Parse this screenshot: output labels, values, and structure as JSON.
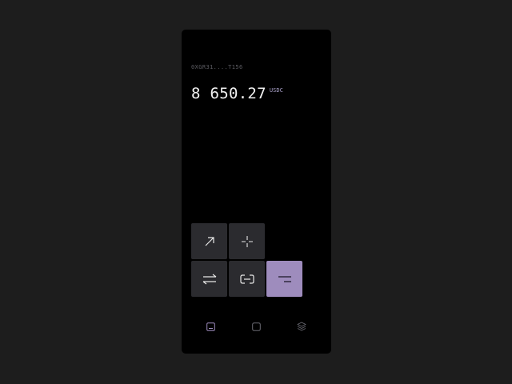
{
  "wallet": {
    "address": "0XGR31....T156",
    "balance": "8 650.27",
    "currency": "USDC"
  },
  "actions": [
    {
      "name": "send",
      "icon": "arrow-up-right-icon"
    },
    {
      "name": "receive",
      "icon": "receive-cross-icon"
    },
    {
      "name": "swap",
      "icon": "swap-arrows-icon"
    },
    {
      "name": "scan",
      "icon": "scan-link-icon"
    },
    {
      "name": "menu",
      "icon": "menu-lines-icon",
      "active": true
    }
  ],
  "bottom_nav": [
    {
      "name": "wallet",
      "icon": "wallet-icon",
      "active": true
    },
    {
      "name": "home",
      "icon": "square-icon"
    },
    {
      "name": "layers",
      "icon": "layers-icon"
    }
  ],
  "colors": {
    "background": "#1d1d1d",
    "screen": "#000000",
    "tile": "#2b2b2f",
    "accent": "#9e8cbd",
    "accent_text": "#a9a0c8"
  }
}
